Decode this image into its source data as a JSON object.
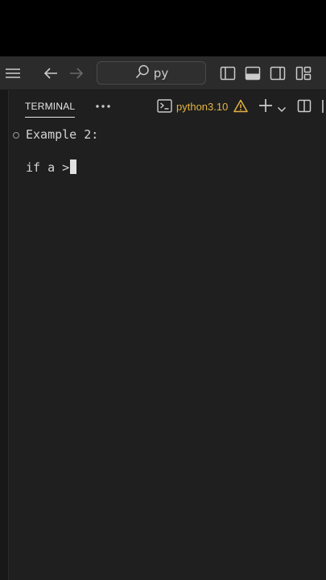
{
  "search": {
    "text": "py"
  },
  "panel": {
    "tab_label": "TERMINAL",
    "profile": "python3.10"
  },
  "terminal": {
    "lines": [
      "Example 2:",
      "if a >"
    ]
  },
  "colors": {
    "background": "#1e1e1e",
    "titlebar": "#2b2b2b",
    "profile_accent": "#e2b340"
  },
  "icons": [
    "menu-icon",
    "back-arrow-icon",
    "forward-arrow-icon",
    "search-icon",
    "toggle-sidebar-icon",
    "toggle-panel-icon",
    "toggle-secondary-sidebar-icon",
    "customize-layout-icon",
    "more-actions-icon",
    "terminal-icon",
    "warning-icon",
    "new-terminal-plus-icon",
    "chevron-down-icon",
    "split-terminal-icon",
    "kill-terminal-icon"
  ]
}
